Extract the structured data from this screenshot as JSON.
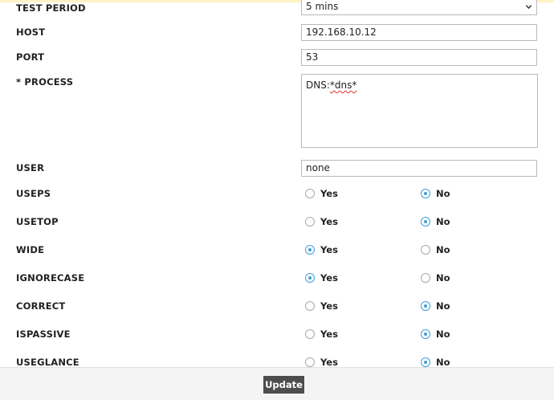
{
  "fields": {
    "test_period": {
      "label": "TEST PERIOD",
      "value": "5 mins"
    },
    "host": {
      "label": "HOST",
      "value": "192.168.10.12"
    },
    "port": {
      "label": "PORT",
      "value": "53"
    },
    "process": {
      "label": "* PROCESS",
      "value_prefix": "DNS:",
      "value_word": "*dns*"
    },
    "user": {
      "label": "USER",
      "value": "none"
    }
  },
  "radio_yes": "Yes",
  "radio_no": "No",
  "radios": [
    {
      "label": "USEPS",
      "selected": "No"
    },
    {
      "label": "USETOP",
      "selected": "No"
    },
    {
      "label": "WIDE",
      "selected": "Yes"
    },
    {
      "label": "IGNORECASE",
      "selected": "Yes"
    },
    {
      "label": "CORRECT",
      "selected": "No"
    },
    {
      "label": "ISPASSIVE",
      "selected": "No"
    },
    {
      "label": "USEGLANCE",
      "selected": "No"
    }
  ],
  "footer": {
    "update_label": "Update"
  },
  "colors": {
    "radio_selected": "#3aa0d8",
    "button_bg": "#4d4d4d"
  },
  "icons": {
    "select_toggle": "chevron-down-icon"
  }
}
